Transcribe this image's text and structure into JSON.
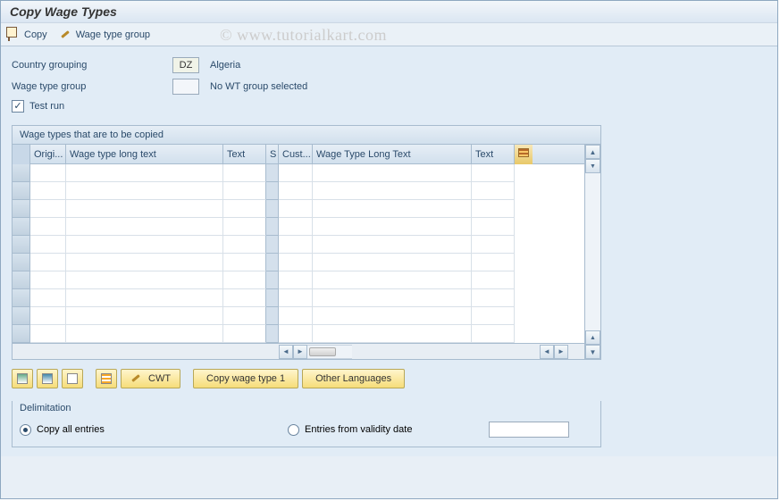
{
  "title": "Copy Wage Types",
  "watermark": "© www.tutorialkart.com",
  "toolbar": {
    "copy_label": "Copy",
    "wt_group_label": "Wage type group"
  },
  "form": {
    "country_grouping_label": "Country grouping",
    "country_grouping_value": "DZ",
    "country_grouping_desc": "Algeria",
    "wage_type_group_label": "Wage type group",
    "wage_type_group_value": "",
    "wage_type_group_desc": "No WT group selected",
    "test_run_label": "Test run",
    "test_run_checked": true
  },
  "table": {
    "title": "Wage types that are to be copied",
    "columns": {
      "origi": "Origi...",
      "wt_long_text": "Wage type long text",
      "text": "Text",
      "s": "S",
      "cust": "Cust...",
      "wt_long_text2": "Wage Type Long Text",
      "text2": "Text"
    },
    "row_count": 10
  },
  "buttons": {
    "cwt_label": "CWT",
    "copy_wt1_label": "Copy wage type 1",
    "other_lang_label": "Other Languages"
  },
  "delimitation": {
    "title": "Delimitation",
    "copy_all_label": "Copy all entries",
    "entries_from_label": "Entries from validity date",
    "selected": "copy_all",
    "date_value": ""
  }
}
